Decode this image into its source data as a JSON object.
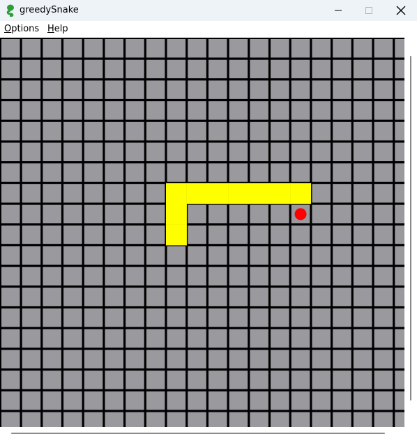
{
  "window": {
    "title": "greedySnake",
    "icon": "snake-app-icon",
    "controls": [
      "minimize-icon",
      "maximize-icon",
      "close-icon"
    ]
  },
  "menu": {
    "options_label": "Options",
    "help_label": "Help"
  },
  "game": {
    "grid_cols": 20,
    "grid_rows": 19,
    "cell_color": "#9a999e",
    "grid_line_color": "#000000",
    "snake_color": "#ffff00",
    "food_color": "#ff0000",
    "snake": [
      [
        8,
        7
      ],
      [
        9,
        7
      ],
      [
        10,
        7
      ],
      [
        11,
        7
      ],
      [
        12,
        7
      ],
      [
        13,
        7
      ],
      [
        14,
        7
      ],
      [
        8,
        8
      ],
      [
        8,
        9
      ]
    ],
    "food": [
      14,
      8
    ]
  }
}
